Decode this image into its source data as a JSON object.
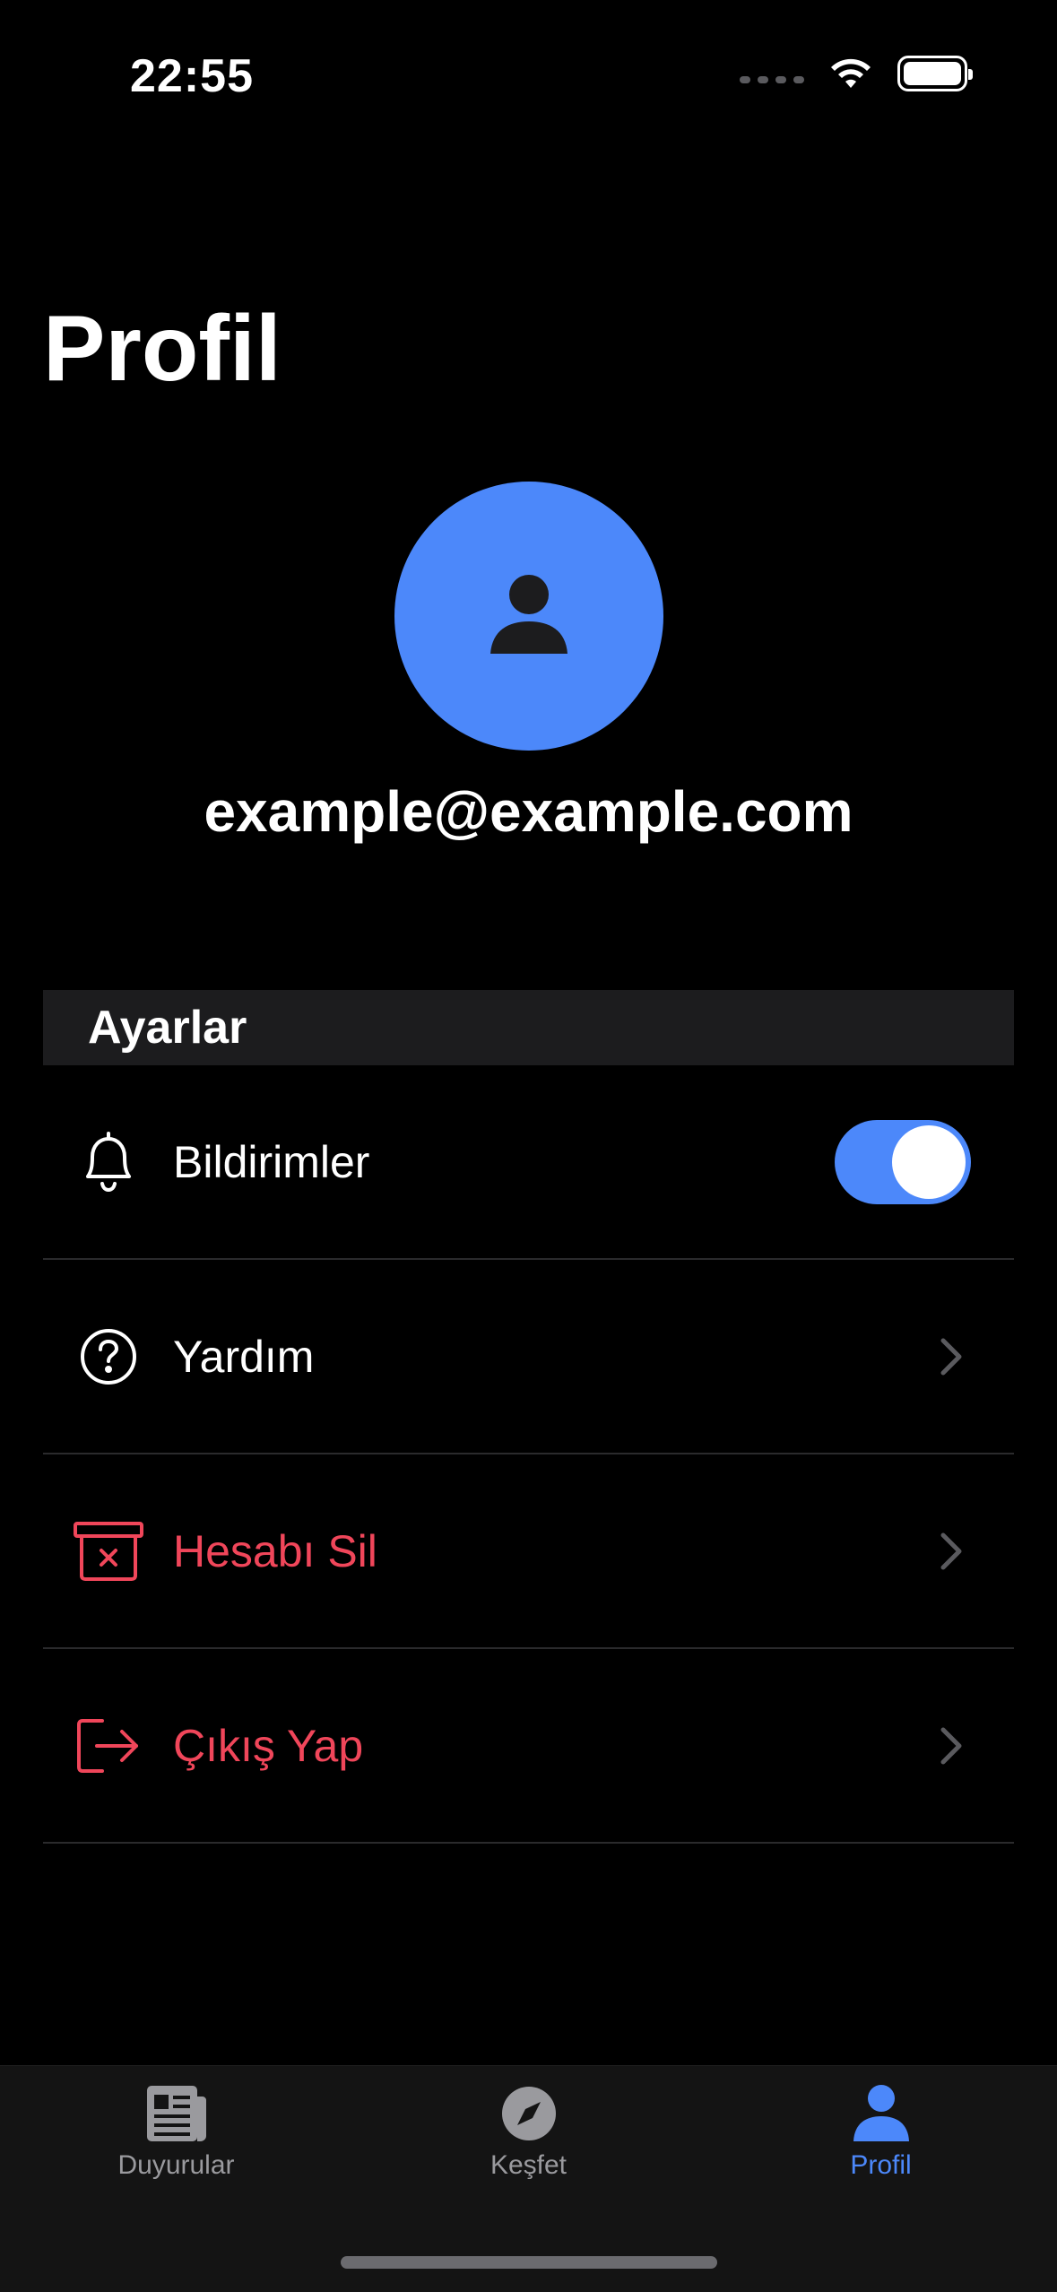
{
  "status_bar": {
    "time": "22:55"
  },
  "page": {
    "title": "Profil"
  },
  "profile": {
    "email": "example@example.com"
  },
  "settings": {
    "section_title": "Ayarlar",
    "notifications": {
      "label": "Bildirimler",
      "enabled": true
    },
    "items": [
      {
        "label": "Yardım",
        "icon": "help-circle-icon"
      },
      {
        "label": "Hesabı Sil",
        "icon": "delete-account-icon"
      },
      {
        "label": "Çıkış Yap",
        "icon": "logout-icon"
      }
    ]
  },
  "tab_bar": {
    "tabs": [
      {
        "label": "Duyurular",
        "icon": "newspaper-icon",
        "active": false
      },
      {
        "label": "Keşfet",
        "icon": "compass-icon",
        "active": false
      },
      {
        "label": "Profil",
        "icon": "person-icon",
        "active": true
      }
    ]
  },
  "colors": {
    "accent": "#4c88fa",
    "danger": "#f0465a",
    "background": "#000000",
    "section_bg": "#1c1c1e"
  }
}
